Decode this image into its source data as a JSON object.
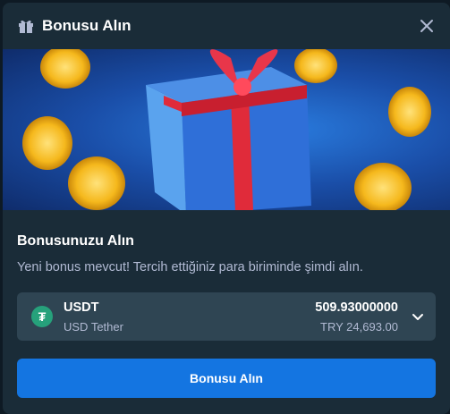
{
  "header": {
    "title": "Bonusu Alın",
    "gift_icon": "gift-icon",
    "close_icon": "close-icon"
  },
  "banner": {
    "image": "gift-box-with-coins-illustration"
  },
  "section": {
    "title": "Bonusunuzu Alın",
    "description": "Yeni bonus mevcut! Tercih ettiğiniz para biriminde şimdi alın."
  },
  "currency": {
    "code": "USDT",
    "name": "USD Tether",
    "amount": "509.93000000",
    "fiat": "TRY 24,693.00",
    "icon_symbol": "₮",
    "icon_color": "#26a17b"
  },
  "cta": {
    "label": "Bonusu Alın"
  },
  "colors": {
    "background": "#1a2c38",
    "field": "#2f4553",
    "accent": "#1475e1",
    "muted": "#b1bad3"
  }
}
